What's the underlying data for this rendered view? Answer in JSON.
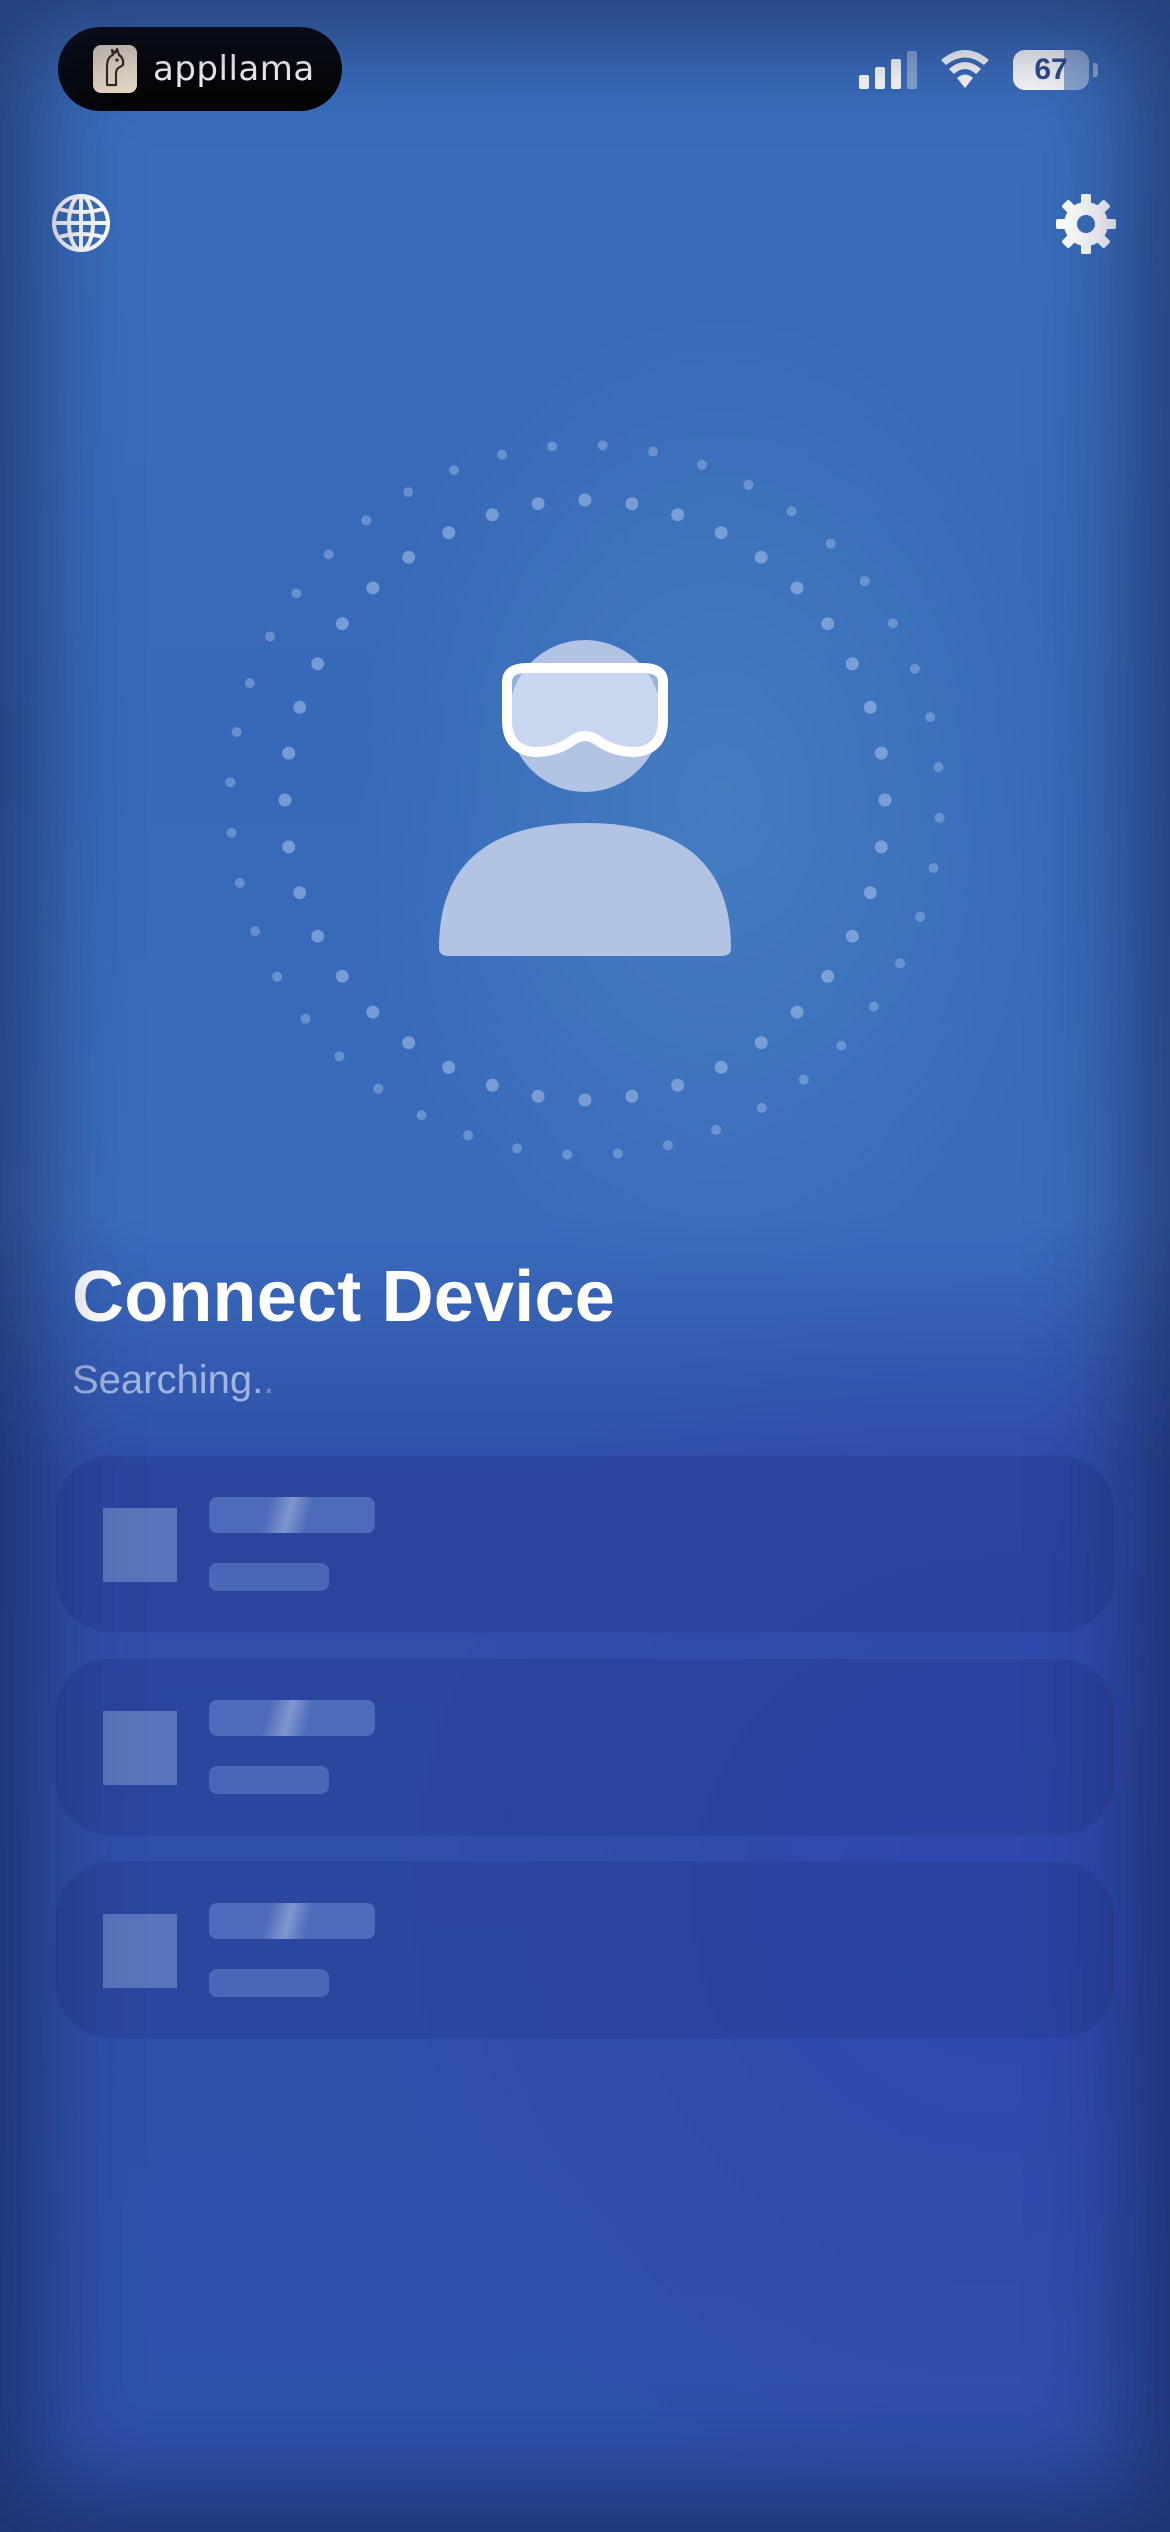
{
  "status_bar": {
    "app_name": "appllama",
    "battery_level": "67",
    "signal_icon": "cellular-signal-icon",
    "wifi_icon": "wifi-icon",
    "battery_icon": "battery-icon"
  },
  "header": {
    "left_icon": "globe-icon",
    "right_icon": "gear-icon"
  },
  "illustration": {
    "icon": "person-with-vision-headset-icon"
  },
  "main": {
    "title": "Connect Device",
    "status": "Searching.",
    "status_faded_dot": "."
  },
  "device_placeholders": [
    {
      "state": "loading"
    },
    {
      "state": "loading"
    },
    {
      "state": "loading"
    }
  ],
  "colors": {
    "background_top": "#3a6dbb",
    "background_bottom": "#2e51aa",
    "text_primary": "#ffffff"
  }
}
